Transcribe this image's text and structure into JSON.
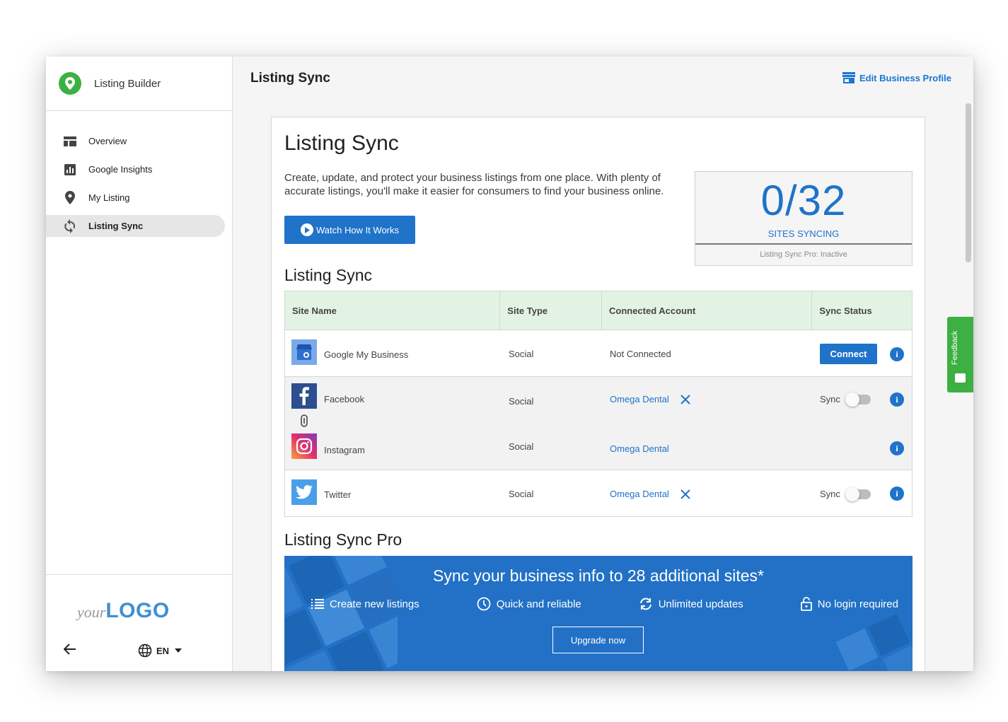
{
  "app": {
    "title": "Listing Builder"
  },
  "sidebar": {
    "items": [
      {
        "label": "Overview",
        "icon": "dashboard-icon",
        "active": false
      },
      {
        "label": "Google Insights",
        "icon": "bar-chart-icon",
        "active": false
      },
      {
        "label": "My Listing",
        "icon": "location-pin-icon",
        "active": false
      },
      {
        "label": "Listing Sync",
        "icon": "sync-icon",
        "active": true
      }
    ],
    "logo_prefix": "your",
    "logo_main": "LOGO",
    "language": "EN"
  },
  "header": {
    "title": "Listing Sync",
    "edit_link": "Edit Business Profile"
  },
  "main": {
    "title": "Listing Sync",
    "description": "Create, update, and protect your business listings from one place. With plenty of accurate listings, you'll make it easier for consumers to find your business online.",
    "watch_button": "Watch How It Works",
    "stats": {
      "count": "0/32",
      "label": "SITES SYNCING",
      "footer": "Listing Sync Pro: Inactive"
    },
    "table_title": "Listing Sync",
    "table": {
      "headers": [
        "Site Name",
        "Site Type",
        "Connected Account",
        "Sync Status"
      ],
      "rows": [
        {
          "site": "Google My Business",
          "type": "Social",
          "account": "Not Connected",
          "action": "Connect"
        },
        {
          "site": "Facebook",
          "type": "Social",
          "account": "Omega Dental",
          "sync_label": "Sync"
        },
        {
          "site": "Instagram",
          "type": "Social",
          "account": "Omega Dental"
        },
        {
          "site": "Twitter",
          "type": "Social",
          "account": "Omega Dental",
          "sync_label": "Sync"
        }
      ]
    },
    "pro_title": "Listing Sync Pro",
    "promo": {
      "headline": "Sync your business info to 28 additional sites*",
      "features": [
        "Create new listings",
        "Quick and reliable",
        "Unlimited updates",
        "No login required"
      ],
      "button": "Upgrade now"
    }
  },
  "feedback": {
    "label": "Feedback"
  },
  "colors": {
    "accent": "#1f73c9",
    "header_green": "#e3f3e3",
    "feedback_green": "#3cb043",
    "promo_blue": "#2271c6"
  }
}
